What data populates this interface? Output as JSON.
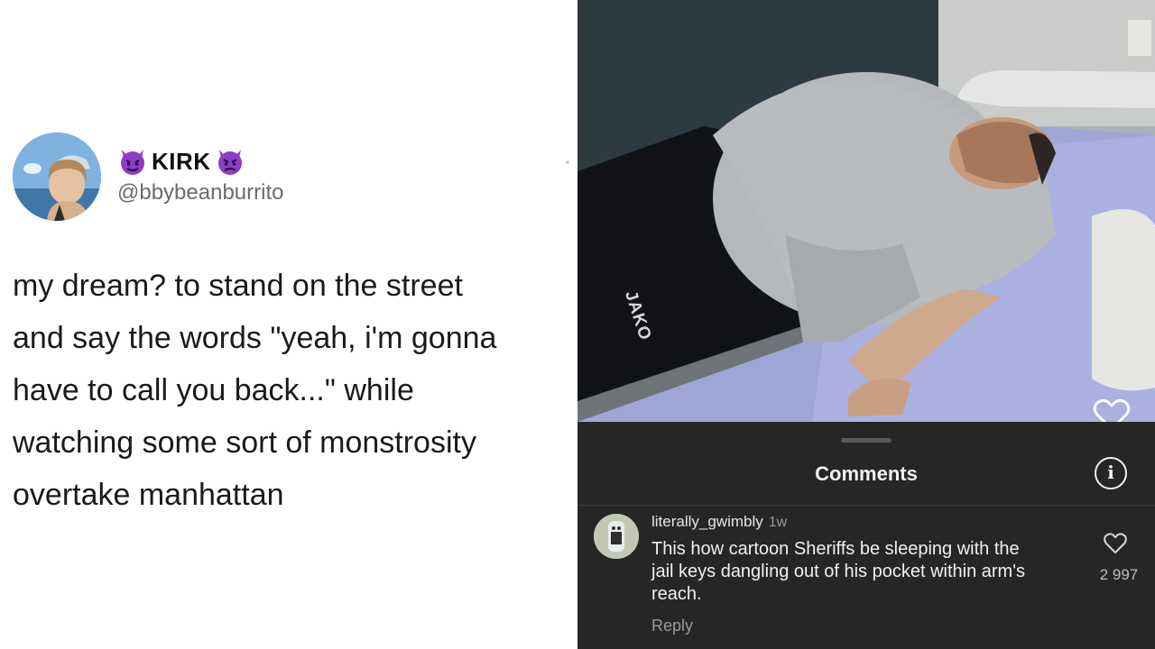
{
  "tweet": {
    "display_name": "KIRK",
    "handle": "@bbybeanburrito",
    "text_lines": [
      "my dream? to stand on the street",
      "and say the words \"yeah, i'm gonna",
      "have to call you back...\" while",
      "watching some sort of monstrosity",
      "overtake manhattan"
    ],
    "name_icons": [
      "smiling-devil-icon",
      "angry-devil-icon"
    ]
  },
  "photo": {
    "shorts_brand": "JAKO",
    "like_icon": "heart-outline-icon"
  },
  "comments_sheet": {
    "title": "Comments",
    "info_icon": "info-circle-icon",
    "comment": {
      "username": "literally_gwimbly",
      "time": "1w",
      "text_lines": [
        "This how cartoon Sheriffs be sleeping with the",
        "jail keys dangling out of his pocket within arm's",
        "reach."
      ],
      "likes": "2 997",
      "reply_label": "Reply"
    }
  },
  "colors": {
    "sheet_bg": "#262626",
    "devil_purple": "#8a3fc6",
    "handle_gray": "#6b6b6b"
  }
}
